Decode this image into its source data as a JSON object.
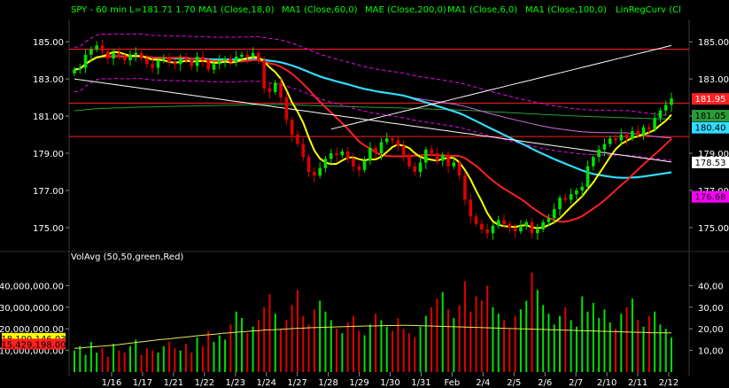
{
  "header": {
    "symbol_label": "SPY - 60 min  L=181.71  1.70",
    "studies": [
      "MA1 (Close,18,0)",
      "MA1 (Close,60,0)",
      "MAE (Close,200,0)",
      "MA1 (Close,6,0)",
      "MA1 (Close,100,0)",
      "LinRegCurv (Cl"
    ]
  },
  "volume_panel": {
    "title": "VolAvg (50,50,green,Red)"
  },
  "colors": {
    "background": "#000000",
    "up": "#00e000",
    "down": "#e00000",
    "ma6": "#ffff00",
    "ma18": "#ff2020",
    "ma60": "#33dbff",
    "ma100": "#d070e0",
    "mae": "#ff00ff",
    "ma200": "#2e9b3a",
    "linreg": "#ffffff",
    "vol_avg": "#e8e860",
    "hline": "#ff2222",
    "header_text": "#00ff00"
  },
  "chart_data": [
    {
      "type": "candlestick",
      "title": "SPY - 60 min",
      "last": 181.71,
      "change": 1.7,
      "x_tick_labels": [
        "1/16",
        "1/17",
        "1/21",
        "1/22",
        "1/23",
        "1/24",
        "1/27",
        "1/28",
        "1/29",
        "1/30",
        "1/31",
        "Feb",
        "2/4",
        "2/5",
        "2/6",
        "2/7",
        "2/10",
        "2/11",
        "2/12"
      ],
      "y_tick_labels": [
        "185.00",
        "183.00",
        "181.00",
        "179.00",
        "177.00",
        "175.00"
      ],
      "ylim": [
        173.9,
        186.2
      ],
      "horizontal_lines": [
        184.6,
        181.7,
        179.9
      ],
      "price_tags": [
        {
          "value": 181.95,
          "label": "181.95",
          "bg": "#ff2020",
          "fg": "#ffffff"
        },
        {
          "value": 181.05,
          "label": "181.05",
          "bg": "#2e9b3a",
          "fg": "#000000"
        },
        {
          "value": 180.4,
          "label": "180.40",
          "bg": "#33dbff",
          "fg": "#000000"
        },
        {
          "value": 178.53,
          "label": "178.53",
          "bg": "#ffffff",
          "fg": "#000000"
        },
        {
          "value": 176.68,
          "label": "176.68",
          "bg": "#ff00ff",
          "fg": "#000000"
        }
      ],
      "closes": [
        183.5,
        183.6,
        184.3,
        184.6,
        184.8,
        184.5,
        184.1,
        184.4,
        184.2,
        184.0,
        184.3,
        184.4,
        184.1,
        183.8,
        183.6,
        184.0,
        184.1,
        183.9,
        183.8,
        184.1,
        184.0,
        183.7,
        184.2,
        184.0,
        183.5,
        183.8,
        184.0,
        184.1,
        183.9,
        184.2,
        184.3,
        184.2,
        184.4,
        184.0,
        182.5,
        182.3,
        182.8,
        182.0,
        180.8,
        180.0,
        179.5,
        178.8,
        178.0,
        177.8,
        178.2,
        178.7,
        179.0,
        178.9,
        179.1,
        178.7,
        178.3,
        178.1,
        178.6,
        179.3,
        179.0,
        179.6,
        179.8,
        179.7,
        179.4,
        178.9,
        178.3,
        178.0,
        178.5,
        179.2,
        179.0,
        178.6,
        178.9,
        178.3,
        178.5,
        177.8,
        176.5,
        175.6,
        175.2,
        174.9,
        174.7,
        175.1,
        175.4,
        175.2,
        175.0,
        174.8,
        175.1,
        175.3,
        174.7,
        174.9,
        175.3,
        175.5,
        176.0,
        176.6,
        176.5,
        176.8,
        177.0,
        177.2,
        178.3,
        178.8,
        179.2,
        179.5,
        179.8,
        179.7,
        180.0,
        179.8,
        180.2,
        180.0,
        180.4,
        180.3,
        180.9,
        181.3,
        181.6,
        181.95
      ],
      "series": [
        {
          "name": "MA1 (Close,6,0)",
          "role": "ma6"
        },
        {
          "name": "MA1 (Close,18,0)",
          "role": "ma18"
        },
        {
          "name": "MA1 (Close,60,0)",
          "role": "ma60"
        },
        {
          "name": "MA1 (Close,100,0)",
          "role": "ma100"
        },
        {
          "name": "MAE (Close,200,0)",
          "role": "mae"
        },
        {
          "name": "LinRegCurv (Cl",
          "role": "linreg"
        }
      ]
    },
    {
      "type": "bar",
      "title": "VolAvg (50,50,green,Red)",
      "y_tick_labels": [
        "40,000,000.00",
        "30,000,000.00",
        "20,000,000.00",
        "10,000,000.00"
      ],
      "right_tick_labels": [
        "40,00",
        "30,00",
        "20,00",
        "10,00"
      ],
      "ylim": [
        0,
        50000000
      ],
      "tags": [
        {
          "label": "18,100,146.03",
          "value": 18100146,
          "bg": "#ffff00",
          "fg": "#000000"
        },
        {
          "label": "15,429,198.00",
          "value": 15429198,
          "bg": "#ff2020",
          "fg": "#000000"
        }
      ],
      "values": [
        10,
        12,
        8,
        14,
        9,
        11,
        7,
        13,
        10,
        9,
        12,
        15,
        8,
        11,
        10,
        9,
        12,
        14,
        11,
        10,
        13,
        9,
        16,
        12,
        19,
        14,
        17,
        15,
        22,
        28,
        25,
        18,
        21,
        24,
        30,
        36,
        27,
        20,
        24,
        31,
        38,
        26,
        22,
        29,
        33,
        28,
        24,
        20,
        18,
        23,
        26,
        19,
        17,
        22,
        27,
        24,
        21,
        19,
        25,
        20,
        18,
        16,
        21,
        26,
        30,
        34,
        37,
        29,
        25,
        31,
        42,
        28,
        35,
        33,
        40,
        30,
        27,
        24,
        20,
        26,
        29,
        33,
        46,
        38,
        31,
        27,
        22,
        26,
        30,
        24,
        21,
        35,
        28,
        32,
        25,
        29,
        23,
        20,
        27,
        30,
        34,
        24,
        21,
        26,
        28,
        22,
        20,
        16
      ],
      "avg_values": [
        11,
        11.2,
        11.5,
        11.8,
        12,
        12.3,
        12.6,
        13,
        13.4,
        13.8,
        14.2,
        14.6,
        15,
        15.3,
        15.6,
        16,
        16.3,
        16.7,
        17,
        17.3,
        17.6,
        18,
        18.2,
        18.5,
        18.7,
        19,
        19.2,
        19.5,
        19.6,
        19.8,
        20,
        20.2,
        20.3,
        20.5,
        20.6,
        20.7,
        20.8,
        20.9,
        21,
        21.1,
        21.2,
        21.3,
        21.3,
        21.4,
        21.5,
        21.5,
        21.6,
        21.6,
        21.5,
        21.4,
        21.3,
        21.2,
        21.1,
        21,
        20.9,
        20.8,
        20.7,
        20.6,
        20.5,
        20.4,
        20.3,
        20.2,
        20.1,
        20,
        19.9,
        19.8,
        19.7,
        19.6,
        19.5,
        19.4,
        19.3,
        19.2,
        19.1,
        19,
        18.9,
        18.8,
        18.7,
        18.6,
        18.5,
        18.4,
        18.3,
        18.2,
        18.2,
        18.1,
        18.1
      ]
    }
  ]
}
